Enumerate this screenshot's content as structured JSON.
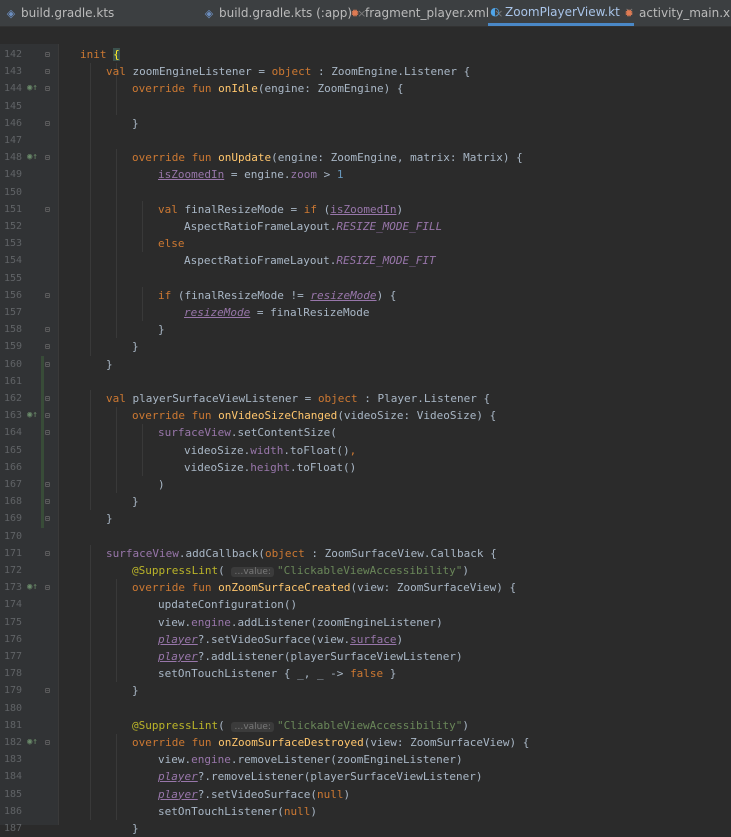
{
  "tabs": [
    {
      "label": "build.gradle.kts",
      "icon": "gradle-icon",
      "active": false
    },
    {
      "label": "build.gradle.kts (:app)",
      "icon": "gradle-icon",
      "active": false
    },
    {
      "label": "fragment_player.xml",
      "icon": "xml-icon",
      "active": false
    },
    {
      "label": "ZoomPlayerView.kt",
      "icon": "kotlin-file-icon",
      "active": true
    },
    {
      "label": "activity_main.xml",
      "icon": "xml-icon",
      "active": false
    }
  ],
  "gutter": {
    "override_markers": [
      144,
      148,
      163,
      173,
      182
    ],
    "changed_ranges": [
      [
        160,
        169
      ]
    ]
  },
  "lines": [
    {
      "n": "142",
      "indent": 0,
      "parts": [
        [
          "kw",
          "init "
        ],
        [
          "bh",
          "{"
        ]
      ]
    },
    {
      "n": "143",
      "indent": 1,
      "parts": [
        [
          "kw",
          "val "
        ],
        [
          "p",
          "zoomEngineListener = "
        ],
        [
          "kw",
          "object"
        ],
        [
          "p",
          " : ZoomEngine.Listener {"
        ]
      ]
    },
    {
      "n": "144",
      "indent": 2,
      "parts": [
        [
          "kw",
          "override fun "
        ],
        [
          "fn",
          "onIdle"
        ],
        [
          "p",
          "(engine: ZoomEngine) {"
        ]
      ]
    },
    {
      "n": "145",
      "indent": 0,
      "parts": []
    },
    {
      "n": "146",
      "indent": 2,
      "parts": [
        [
          "p",
          "}"
        ]
      ]
    },
    {
      "n": "147",
      "indent": 0,
      "parts": []
    },
    {
      "n": "148",
      "indent": 2,
      "parts": [
        [
          "kw",
          "override fun "
        ],
        [
          "fn",
          "onUpdate"
        ],
        [
          "p",
          "(engine: ZoomEngine, matrix: Matrix) {"
        ]
      ]
    },
    {
      "n": "149",
      "indent": 3,
      "parts": [
        [
          "uvar",
          "isZoomedIn"
        ],
        [
          "p",
          " = engine."
        ],
        [
          "prop",
          "zoom"
        ],
        [
          "p",
          " > "
        ],
        [
          "num",
          "1"
        ]
      ]
    },
    {
      "n": "150",
      "indent": 0,
      "parts": []
    },
    {
      "n": "151",
      "indent": 3,
      "parts": [
        [
          "kw",
          "val "
        ],
        [
          "p",
          "finalResizeMode = "
        ],
        [
          "kw",
          "if "
        ],
        [
          "p",
          "("
        ],
        [
          "uvar",
          "isZoomedIn"
        ],
        [
          "p",
          ")"
        ]
      ]
    },
    {
      "n": "152",
      "indent": 4,
      "parts": [
        [
          "p",
          "AspectRatioFrameLayout."
        ],
        [
          "const",
          "RESIZE_MODE_FILL"
        ]
      ]
    },
    {
      "n": "153",
      "indent": 3,
      "parts": [
        [
          "kw",
          "else"
        ]
      ]
    },
    {
      "n": "154",
      "indent": 4,
      "parts": [
        [
          "p",
          "AspectRatioFrameLayout."
        ],
        [
          "const",
          "RESIZE_MODE_FIT"
        ]
      ]
    },
    {
      "n": "155",
      "indent": 0,
      "parts": []
    },
    {
      "n": "156",
      "indent": 3,
      "parts": [
        [
          "kw",
          "if "
        ],
        [
          "p",
          "(finalResizeMode != "
        ],
        [
          "mvar",
          "resizeMode"
        ],
        [
          "p",
          ") {"
        ]
      ]
    },
    {
      "n": "157",
      "indent": 4,
      "parts": [
        [
          "mvar",
          "resizeMode"
        ],
        [
          "p",
          " = finalResizeMode"
        ]
      ]
    },
    {
      "n": "158",
      "indent": 3,
      "parts": [
        [
          "p",
          "}"
        ]
      ]
    },
    {
      "n": "159",
      "indent": 2,
      "parts": [
        [
          "p",
          "}"
        ]
      ]
    },
    {
      "n": "160",
      "indent": 1,
      "parts": [
        [
          "p",
          "}"
        ]
      ]
    },
    {
      "n": "161",
      "indent": 0,
      "parts": []
    },
    {
      "n": "162",
      "indent": 1,
      "parts": [
        [
          "kw",
          "val "
        ],
        [
          "p",
          "playerSurfaceViewListener = "
        ],
        [
          "kw",
          "object"
        ],
        [
          "p",
          " : Player.Listener {"
        ]
      ]
    },
    {
      "n": "163",
      "indent": 2,
      "parts": [
        [
          "kw",
          "override fun "
        ],
        [
          "fn",
          "onVideoSizeChanged"
        ],
        [
          "p",
          "(videoSize: VideoSize) {"
        ]
      ]
    },
    {
      "n": "164",
      "indent": 3,
      "parts": [
        [
          "prop",
          "surfaceView"
        ],
        [
          "p",
          ".setContentSize("
        ]
      ]
    },
    {
      "n": "165",
      "indent": 4,
      "parts": [
        [
          "p",
          "videoSize."
        ],
        [
          "prop",
          "width"
        ],
        [
          "p",
          ".toFloat()"
        ],
        [
          "kw",
          ","
        ]
      ]
    },
    {
      "n": "166",
      "indent": 4,
      "parts": [
        [
          "p",
          "videoSize."
        ],
        [
          "prop",
          "height"
        ],
        [
          "p",
          ".toFloat()"
        ]
      ]
    },
    {
      "n": "167",
      "indent": 3,
      "parts": [
        [
          "p",
          ")"
        ]
      ]
    },
    {
      "n": "168",
      "indent": 2,
      "parts": [
        [
          "p",
          "}"
        ]
      ]
    },
    {
      "n": "169",
      "indent": 1,
      "parts": [
        [
          "p",
          "}"
        ]
      ]
    },
    {
      "n": "170",
      "indent": 0,
      "parts": []
    },
    {
      "n": "171",
      "indent": 1,
      "parts": [
        [
          "prop",
          "surfaceView"
        ],
        [
          "p",
          ".addCallback("
        ],
        [
          "kw",
          "object"
        ],
        [
          "p",
          " : ZoomSurfaceView.Callback {"
        ]
      ]
    },
    {
      "n": "172",
      "indent": 2,
      "parts": [
        [
          "ann",
          "@SuppressLint"
        ],
        [
          "p",
          "( "
        ],
        [
          "hint",
          "…value:"
        ],
        [
          "str",
          "\"ClickableViewAccessibility\""
        ],
        [
          "p",
          ")"
        ]
      ]
    },
    {
      "n": "173",
      "indent": 2,
      "parts": [
        [
          "kw",
          "override fun "
        ],
        [
          "fn",
          "onZoomSurfaceCreated"
        ],
        [
          "p",
          "(view: ZoomSurfaceView) {"
        ]
      ]
    },
    {
      "n": "174",
      "indent": 3,
      "parts": [
        [
          "p",
          "updateConfiguration()"
        ]
      ]
    },
    {
      "n": "175",
      "indent": 3,
      "parts": [
        [
          "p",
          "view."
        ],
        [
          "prop",
          "engine"
        ],
        [
          "p",
          ".addListener(zoomEngineListener)"
        ]
      ]
    },
    {
      "n": "176",
      "indent": 3,
      "parts": [
        [
          "mvar",
          "player"
        ],
        [
          "p",
          "?.setVideoSurface(view."
        ],
        [
          "uvar",
          "surface"
        ],
        [
          "p",
          ")"
        ]
      ]
    },
    {
      "n": "177",
      "indent": 3,
      "parts": [
        [
          "mvar",
          "player"
        ],
        [
          "p",
          "?.addListener(playerSurfaceViewListener)"
        ]
      ]
    },
    {
      "n": "178",
      "indent": 3,
      "parts": [
        [
          "p",
          "setOnTouchListener { _, _ -> "
        ],
        [
          "kw",
          "false"
        ],
        [
          "p",
          " }"
        ]
      ]
    },
    {
      "n": "179",
      "indent": 2,
      "parts": [
        [
          "p",
          "}"
        ]
      ]
    },
    {
      "n": "180",
      "indent": 0,
      "parts": []
    },
    {
      "n": "181",
      "indent": 2,
      "parts": [
        [
          "ann",
          "@SuppressLint"
        ],
        [
          "p",
          "( "
        ],
        [
          "hint",
          "…value:"
        ],
        [
          "str",
          "\"ClickableViewAccessibility\""
        ],
        [
          "p",
          ")"
        ]
      ]
    },
    {
      "n": "182",
      "indent": 2,
      "parts": [
        [
          "kw",
          "override fun "
        ],
        [
          "fn",
          "onZoomSurfaceDestroyed"
        ],
        [
          "p",
          "(view: ZoomSurfaceView) {"
        ]
      ]
    },
    {
      "n": "183",
      "indent": 3,
      "parts": [
        [
          "p",
          "view."
        ],
        [
          "prop",
          "engine"
        ],
        [
          "p",
          ".removeListener(zoomEngineListener)"
        ]
      ]
    },
    {
      "n": "184",
      "indent": 3,
      "parts": [
        [
          "mvar",
          "player"
        ],
        [
          "p",
          "?.removeListener(playerSurfaceViewListener)"
        ]
      ]
    },
    {
      "n": "185",
      "indent": 3,
      "parts": [
        [
          "mvar",
          "player"
        ],
        [
          "p",
          "?.setVideoSurface("
        ],
        [
          "kw",
          "null"
        ],
        [
          "p",
          ")"
        ]
      ]
    },
    {
      "n": "186",
      "indent": 3,
      "parts": [
        [
          "p",
          "setOnTouchListener("
        ],
        [
          "kw",
          "null"
        ],
        [
          "p",
          ")"
        ]
      ]
    },
    {
      "n": "187",
      "indent": 2,
      "parts": [
        [
          "p",
          "}"
        ]
      ]
    }
  ]
}
